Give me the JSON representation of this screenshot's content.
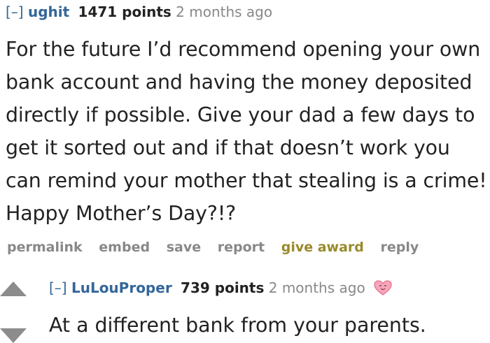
{
  "comment1": {
    "collapse": "[–]",
    "author": "ughit",
    "points": "1471 points",
    "time": "2 months ago",
    "body": "For the future I’d recommend opening your own bank account and having the money deposited directly if possible. Give your dad a few days to get it sorted out and if that doesn’t work you can remind your mother that stealing is a crime! Happy Mother’s Day?!?",
    "actions": {
      "permalink": "permalink",
      "embed": "embed",
      "save": "save",
      "report": "report",
      "give_award": "give award",
      "reply": "reply"
    }
  },
  "comment2": {
    "collapse": "[–]",
    "author": "LuLouProper",
    "points": "739 points",
    "time": "2 months ago",
    "award_icon": "heart-award-icon",
    "body": "At a different bank from your parents."
  },
  "colors": {
    "link": "#336699",
    "text": "#222222",
    "muted": "#888888",
    "gold": "#9a8a2a",
    "award_pink": "#e86f8f"
  }
}
